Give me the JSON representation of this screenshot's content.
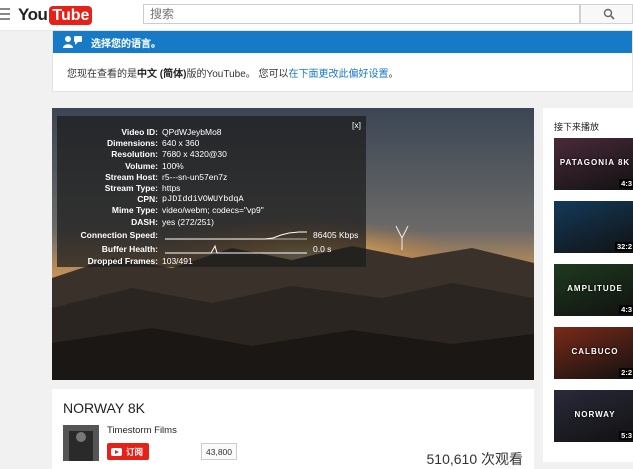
{
  "masthead": {
    "logo_you": "You",
    "logo_tube": "Tube",
    "search_placeholder": "搜索"
  },
  "language_banner": {
    "heading": "选择您的语言。",
    "text_before": "您现在查看的是",
    "language": "中文 (简体)",
    "text_middle": "版的YouTube。 您可以",
    "link": "在下面更改此偏好设置",
    "text_after": "。"
  },
  "stats": {
    "close": "[x]",
    "rows": [
      {
        "label": "Video ID:",
        "value": "QPdWJeybMo8"
      },
      {
        "label": "Dimensions:",
        "value": "640 x 360"
      },
      {
        "label": "Resolution:",
        "value": "7680 x 4320@30"
      },
      {
        "label": "Volume:",
        "value": "100%"
      },
      {
        "label": "Stream Host:",
        "value": "r5---sn-un57en7z"
      },
      {
        "label": "Stream Type:",
        "value": "https"
      },
      {
        "label": "CPN:",
        "value": "pJDIddiVOWUYbdqA"
      },
      {
        "label": "Mime Type:",
        "value": "video/webm; codecs=\"vp9\""
      },
      {
        "label": "DASH:",
        "value": "yes (272/251)"
      }
    ],
    "connection_speed": {
      "label": "Connection Speed:",
      "value": "86405 Kbps"
    },
    "buffer_health": {
      "label": "Buffer Health:",
      "value": "0.0 s"
    },
    "dropped_frames": {
      "label": "Dropped Frames:",
      "value": "103/491"
    }
  },
  "video": {
    "title": "NORWAY 8K",
    "channel": "Timestorm Films",
    "subscribe_label": "订阅",
    "subscriber_count": "43,800",
    "views": "510,610 次观看"
  },
  "sidebar": {
    "up_next": "接下来播放",
    "items": [
      {
        "title": "PATAGONIA 8K",
        "duration": "4:3",
        "color": "#4a2a3a"
      },
      {
        "title": "",
        "duration": "32:2",
        "color": "#123a5a"
      },
      {
        "title": "AMPLITUDE",
        "duration": "4:3",
        "color": "#1e3a1e"
      },
      {
        "title": "CALBUCO",
        "duration": "2:2",
        "color": "#7a2a18"
      },
      {
        "title": "NORWAY",
        "duration": "5:3",
        "color": "#2a2a3a"
      }
    ]
  },
  "colors": {
    "brand_red": "#e62117",
    "banner_blue": "#167ac6",
    "link_blue": "#167ac6"
  }
}
